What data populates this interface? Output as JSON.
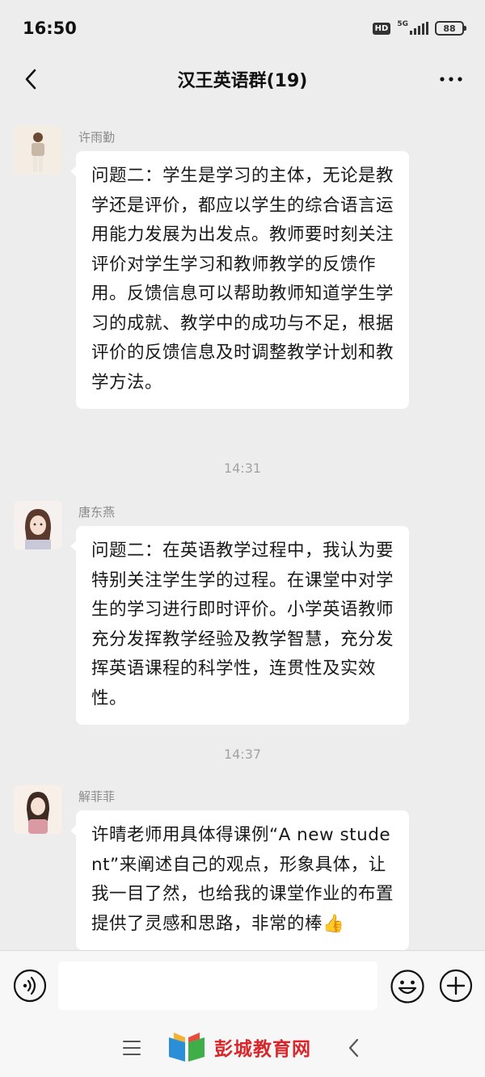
{
  "status_bar": {
    "time": "16:50",
    "hd": "HD",
    "network": "5G",
    "battery": "88"
  },
  "header": {
    "title": "汉王英语群(19)"
  },
  "messages": [
    {
      "sender": "许雨勤",
      "text": "问题二：学生是学习的主体，无论是教学还是评价，都应以学生的综合语言运用能力发展为出发点。教师要时刻关注评价对学生学习和教师教学的反馈作用。反馈信息可以帮助教师知道学生学习的成就、教学中的成功与不足，根据评价的反馈信息及时调整教学计划和教学方法。"
    },
    {
      "timestamp": "14:31"
    },
    {
      "sender": "唐东燕",
      "text": "问题二：在英语教学过程中，我认为要特别关注学生学的过程。在课堂中对学生的学习进行即时评价。小学英语教师充分发挥教学经验及教学智慧，充分发挥英语课程的科学性，连贯性及实效性。"
    },
    {
      "timestamp": "14:37"
    },
    {
      "sender": "解菲菲",
      "text": "许晴老师用具体得课例“A new student”来阐述自己的观点，形象具体，让我一目了然，也给我的课堂作业的布置提供了灵感和思路，非常的棒👍"
    }
  ],
  "input_bar": {
    "placeholder": ""
  },
  "watermark": {
    "text": "彭城教育网"
  },
  "colors": {
    "background": "#ededed",
    "bubble": "#ffffff",
    "text": "#191919",
    "meta": "#8a8a8a",
    "watermark": "#d8262b"
  },
  "icons": [
    "back-arrow-icon",
    "more-icon",
    "voice-icon",
    "emoji-icon",
    "plus-icon",
    "menu-icon",
    "system-back-icon",
    "book-logo-icon"
  ]
}
